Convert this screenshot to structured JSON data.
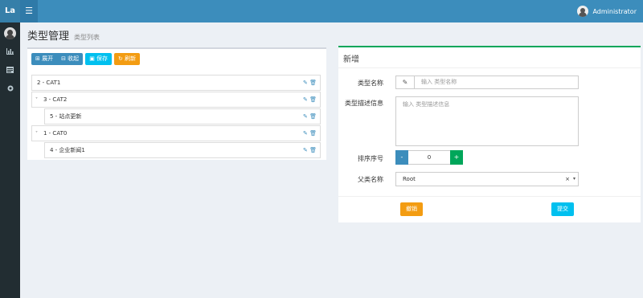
{
  "header": {
    "logo": "La",
    "toggle_icon": "☰",
    "user_name": "Administrator"
  },
  "sidebar": {
    "icons": [
      "user-avatar",
      "bar-chart-icon",
      "list-icon",
      "circle-icon"
    ]
  },
  "page": {
    "title": "类型管理",
    "subtitle": "类型列表"
  },
  "toolbar": {
    "expand_label": "⊞ 展开",
    "collapse_label": "⊟ 收起",
    "save_label": "▣ 保存",
    "refresh_label": "↻ 刷新"
  },
  "tree": {
    "nodes": [
      {
        "label": "2 - CAT1",
        "level": 0,
        "arrow": ""
      },
      {
        "label": "3 - CAT2",
        "level": 0,
        "arrow": "˅"
      },
      {
        "label": "5 - 站点更新",
        "level": 1,
        "arrow": ""
      },
      {
        "label": "1 - CAT0",
        "level": 0,
        "arrow": "˅"
      },
      {
        "label": "4 - 企业新闻1",
        "level": 1,
        "arrow": ""
      }
    ],
    "action_icons": "✎ 🗑"
  },
  "form": {
    "title": "新增",
    "name_label": "类型名称",
    "name_icon": "✎",
    "name_placeholder": "输入 类型名称",
    "desc_label": "类型描述信息",
    "desc_placeholder": "输入 类型描述信息",
    "order_label": "排序序号",
    "order_minus": "-",
    "order_value": "0",
    "order_plus": "+",
    "parent_label": "父类名称",
    "parent_value": "Root",
    "parent_clear": "×",
    "parent_caret": "▾",
    "cancel_label": "撤销",
    "submit_label": "提交"
  },
  "colors": {
    "topbar": "#3c8dbc",
    "sidebar": "#222d32",
    "primary": "#3c8dbc",
    "info": "#00c0ef",
    "warning": "#f39c12",
    "success": "#00a65a"
  }
}
